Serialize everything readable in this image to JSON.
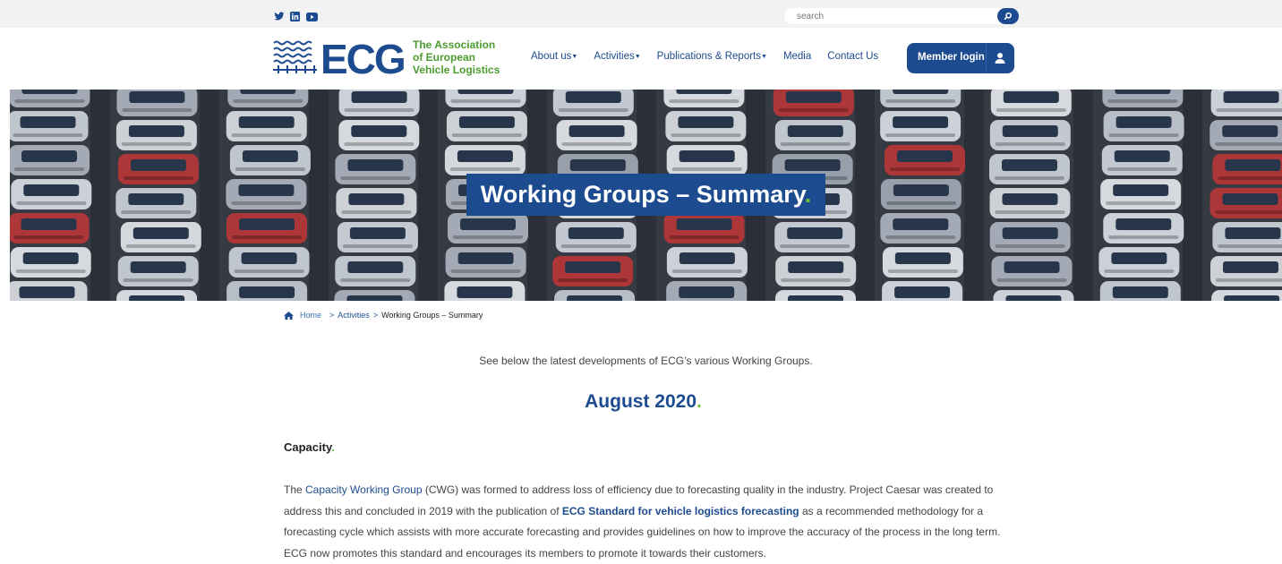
{
  "topbar": {
    "social": [
      "twitter-icon",
      "linkedin-icon",
      "youtube-icon"
    ],
    "search_placeholder": "search"
  },
  "logo": {
    "mark": "ECG",
    "line1": "The Association",
    "line2": "of European",
    "line3": "Vehicle Logistics"
  },
  "nav": {
    "items": [
      {
        "label": "About us",
        "dropdown": true
      },
      {
        "label": "Activities",
        "dropdown": true
      },
      {
        "label": "Publications & Reports",
        "dropdown": true
      },
      {
        "label": "Media",
        "dropdown": false
      },
      {
        "label": "Contact Us",
        "dropdown": false
      }
    ],
    "member_login": "Member login"
  },
  "hero": {
    "title": "Working Groups – Summary",
    "title_dot": "."
  },
  "breadcrumb": {
    "home": "Home",
    "sep": ">",
    "activities": "Activities",
    "current": "Working Groups – Summary"
  },
  "content": {
    "intro": "See below the latest developments of ECG’s various Working Groups.",
    "month": "August 2020",
    "dot": ".",
    "section_title": "Capacity",
    "para": {
      "t1": "The ",
      "link1": "Capacity Working Group",
      "t2": " (CWG) was formed to address loss of efficiency due to forecasting quality in the industry. Project Caesar was created to address this and concluded in 2019 with the publication of ",
      "link2": "ECG Standard for vehicle logistics forecasting",
      "t3": " as a recommended methodology for a forecasting cycle which assists with more accurate forecasting and provides guidelines on how to improve the accuracy of the process in the long term. ECG now promotes this standard and encourages its members to promote it towards their customers."
    }
  },
  "colors": {
    "brand_blue": "#1d4b8f",
    "brand_green": "#4c9c2e",
    "accent_green": "#6bbf3c",
    "topbar_bg": "#f2f2f2"
  }
}
